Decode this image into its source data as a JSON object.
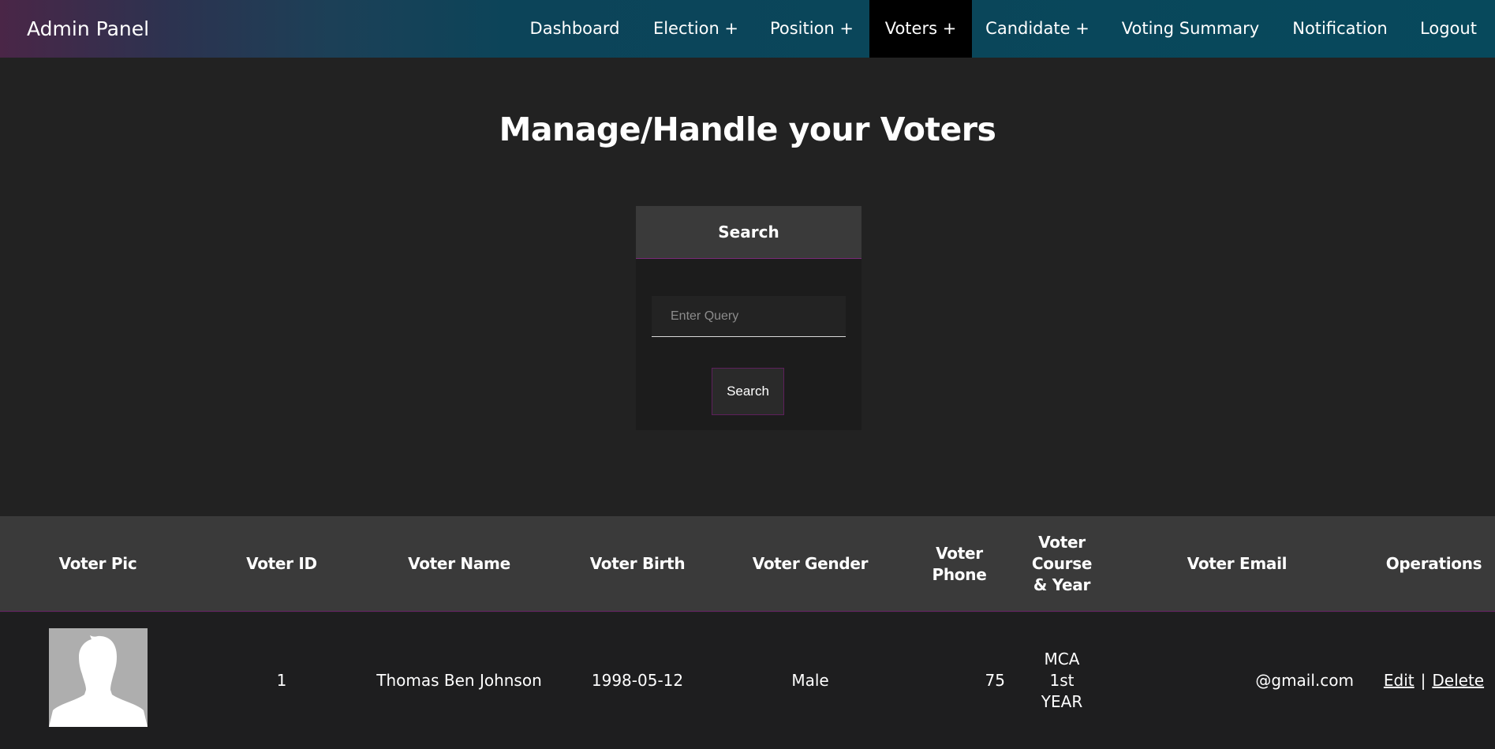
{
  "navbar": {
    "brand": "Admin Panel",
    "items": [
      {
        "label": "Dashboard"
      },
      {
        "label": "Election +"
      },
      {
        "label": "Position +"
      },
      {
        "label": "Voters +"
      },
      {
        "label": "Candidate +"
      },
      {
        "label": "Voting Summary"
      },
      {
        "label": "Notification"
      },
      {
        "label": "Logout"
      }
    ],
    "active_item": "Voters +"
  },
  "main": {
    "title": "Manage/Handle your Voters"
  },
  "search": {
    "header": "Search",
    "placeholder": "Enter Query",
    "value": "",
    "button_label": "Search"
  },
  "table": {
    "headers": {
      "pic": "Voter Pic",
      "id": "Voter ID",
      "name": "Voter Name",
      "birth": "Voter Birth",
      "gender": "Voter Gender",
      "phone_line1": "Voter",
      "phone_line2": "Phone",
      "course_line1": "Voter",
      "course_line2": "Course",
      "course_line3": "& Year",
      "email": "Voter Email",
      "operations": "Operations"
    },
    "rows": [
      {
        "id": "1",
        "name": "Thomas Ben Johnson",
        "birth": "1998-05-12",
        "gender": "Male",
        "phone": "75",
        "course_line1": "MCA",
        "course_line2": "1st",
        "course_line3": "YEAR",
        "email": "@gmail.com",
        "edit_label": "Edit",
        "separator": "|",
        "delete_label": "Delete"
      }
    ]
  },
  "colors": {
    "background": "#222222",
    "nav_gradient_start": "#4a2647",
    "nav_gradient_end": "#07495c",
    "active_nav": "#000000",
    "accent_border": "#6a2468"
  },
  "icons": {
    "avatar": "default-user-silhouette"
  }
}
